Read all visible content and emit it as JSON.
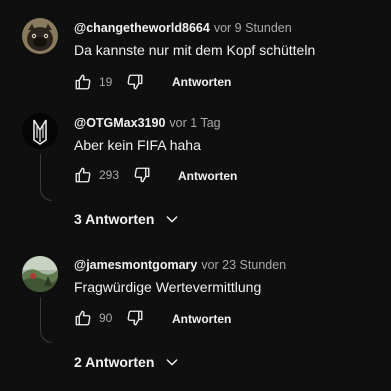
{
  "comments": [
    {
      "handle": "@changetheworld8664",
      "time": "vor 9 Stunden",
      "text": "Da kannste nur mit dem Kopf schütteln",
      "likes": "19",
      "reply_label": "Antworten",
      "avatar": "pug-avatar"
    },
    {
      "handle": "@OTGMax3190",
      "time": "vor 1 Tag",
      "text": "Aber kein FIFA haha",
      "likes": "293",
      "reply_label": "Antworten",
      "avatar": "logo-avatar",
      "replies_label": "3 Antworten"
    },
    {
      "handle": "@jamesmontgomary",
      "time": "vor 23 Stunden",
      "text": "Fragwürdige Wertevermittlung",
      "likes": "90",
      "reply_label": "Antworten",
      "avatar": "landscape-avatar",
      "replies_label": "2 Antworten"
    }
  ],
  "colors": {
    "background": "#0f0f0f",
    "primary_text": "#f1f1f1",
    "secondary_text": "#aaaaaa"
  }
}
